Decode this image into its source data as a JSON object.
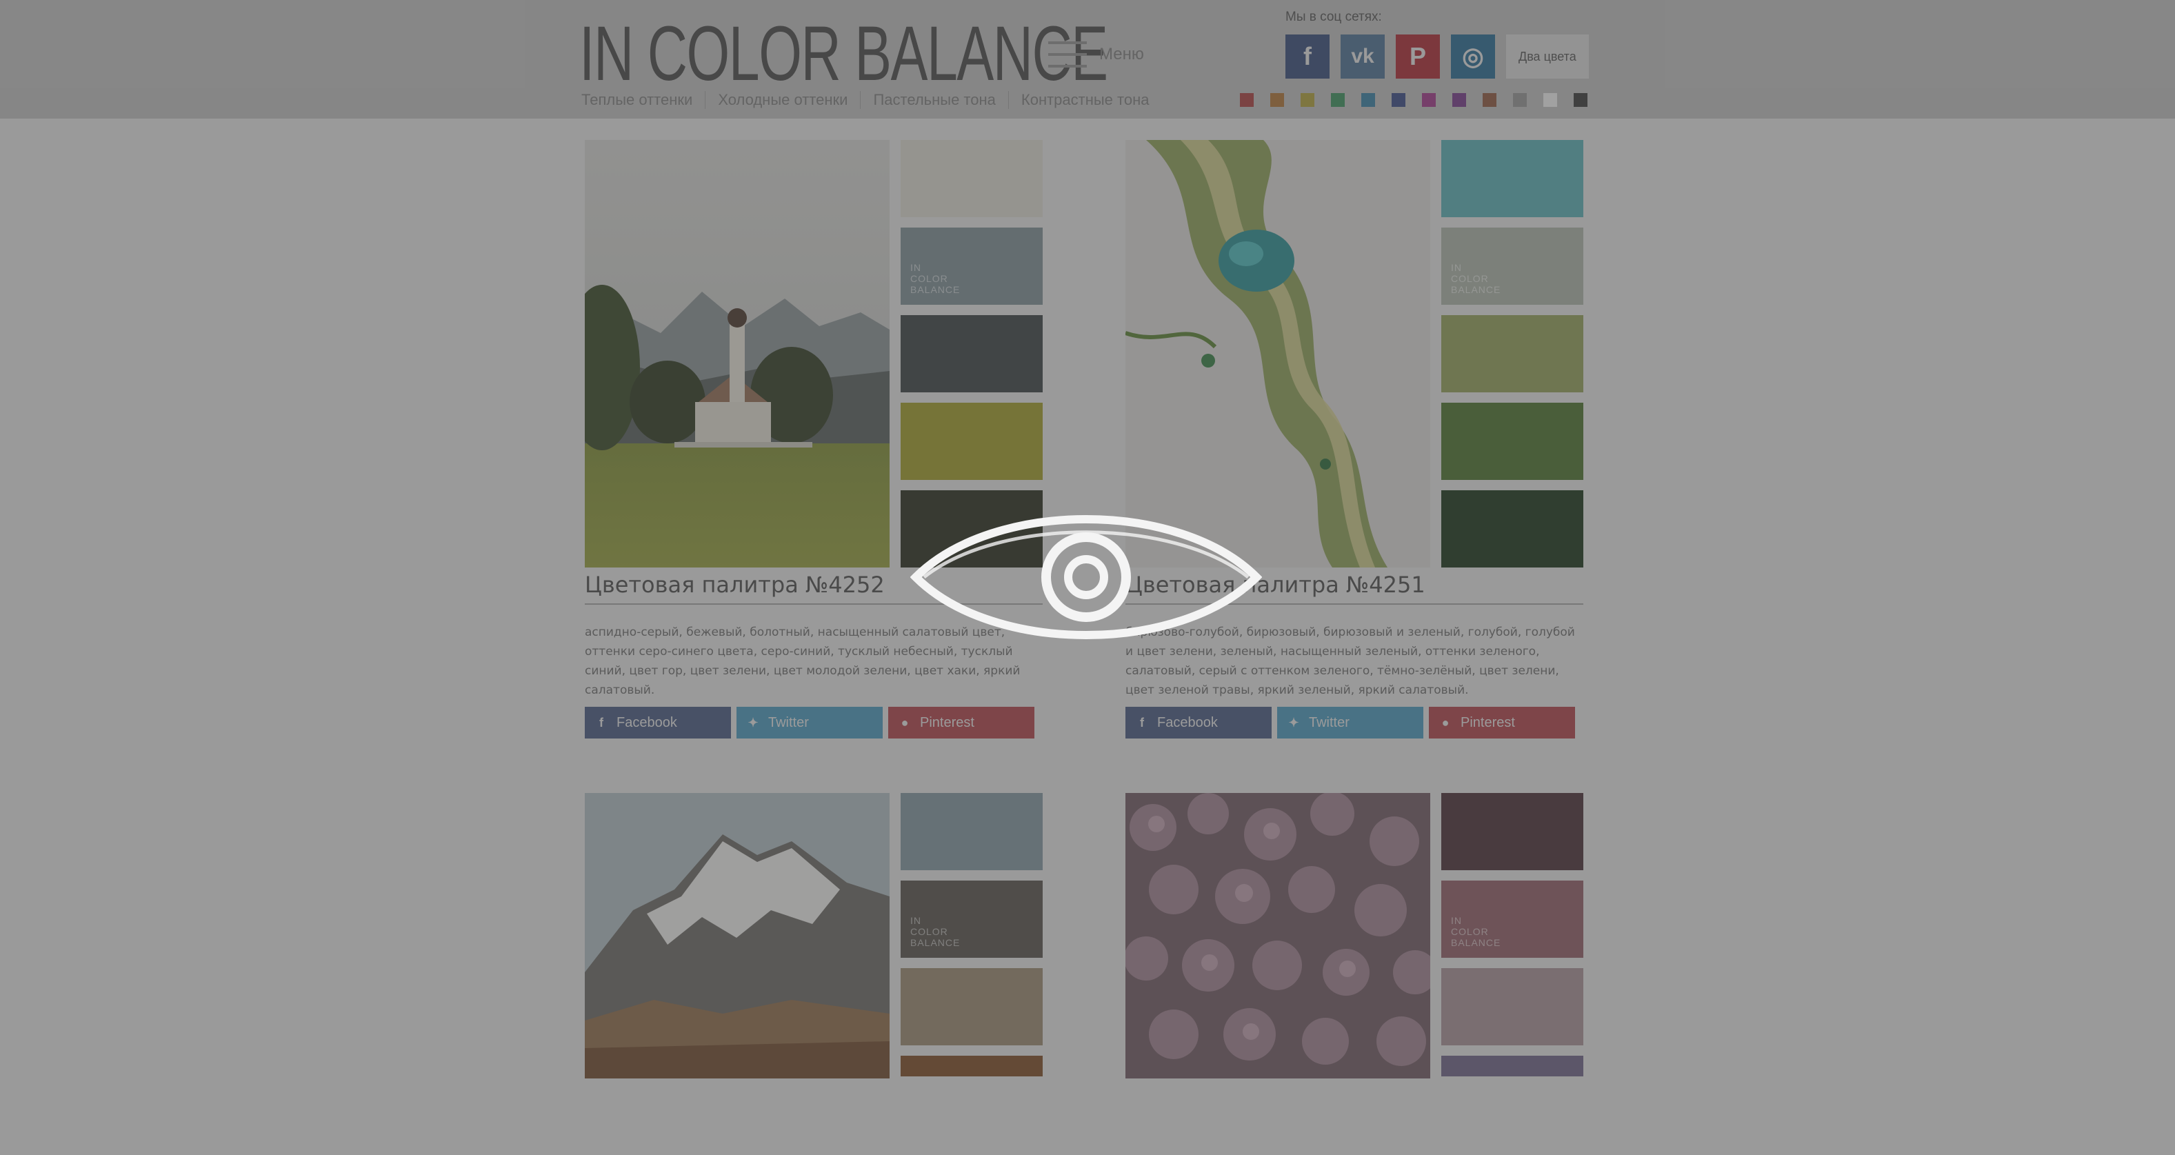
{
  "header": {
    "logo": "IN COLOR BALANCE",
    "menu_label": "Меню",
    "social_caption": "Мы в соц сетях:",
    "social": [
      {
        "name": "facebook",
        "glyph": "f"
      },
      {
        "name": "vk",
        "glyph": "vk"
      },
      {
        "name": "pinterest",
        "glyph": "P"
      },
      {
        "name": "instagram",
        "glyph": "◎"
      }
    ],
    "two_colors_label": "Два цвета",
    "nav": [
      "Теплые оттенки",
      "Холодные оттенки",
      "Пастельные тона",
      "Контрастные тона"
    ],
    "color_filters": [
      "#a24242",
      "#a7733a",
      "#a79a3d",
      "#3e8c5d",
      "#3b7d9d",
      "#3d4c82",
      "#9a3c85",
      "#743d86",
      "#8b5842",
      "#8f8f8f",
      "#e3e3e3",
      "#3d3d3d"
    ]
  },
  "cards": [
    {
      "title": "Цветовая палитра №4252",
      "description": "аспидно-серый, бежевый, болотный, насыщенный салатовый цвет, оттенки серо-синего цвета, серо-синий, тусклый небесный, тусклый синий, цвет гор, цвет зелени, цвет молодой зелени, цвет хаки, яркий салатовый.",
      "palette": [
        "#cfcdc4",
        "#7a8a90",
        "#3f4548",
        "#99962f",
        "#303325"
      ],
      "watermark": [
        "IN",
        "COLOR",
        "BALANCE"
      ],
      "share": {
        "facebook": "Facebook",
        "twitter": "Twitter",
        "pinterest": "Pinterest"
      }
    },
    {
      "title": "Цветовая палитра №4251",
      "description": "бирюзово-голубой, бирюзовый, бирюзовый и зеленый, голубой, голубой и цвет зелени, зеленый, насыщенный зеленый, оттенки зеленого, салатовый, серый с оттенком зеленого, тёмно-зелёный, цвет зелени, цвет зеленой травы, яркий зеленый, яркий салатовый.",
      "palette": [
        "#5aa7ad",
        "#a4aba1",
        "#8d9a5b",
        "#4e7033",
        "#213a21"
      ],
      "watermark": [
        "IN",
        "COLOR",
        "BALANCE"
      ],
      "share": {
        "facebook": "Facebook",
        "twitter": "Twitter",
        "pinterest": "Pinterest"
      }
    },
    {
      "title": "",
      "palette": [
        "#7f9299",
        "#58544e",
        "#95866e",
        "#7a4f2c"
      ],
      "watermark": [
        "IN",
        "COLOR",
        "BALANCE"
      ]
    },
    {
      "title": "",
      "palette": [
        "#4c353b",
        "#8c5e66",
        "#a08c92",
        "#6d6383"
      ],
      "watermark": [
        "IN",
        "COLOR",
        "BALANCE"
      ]
    }
  ]
}
